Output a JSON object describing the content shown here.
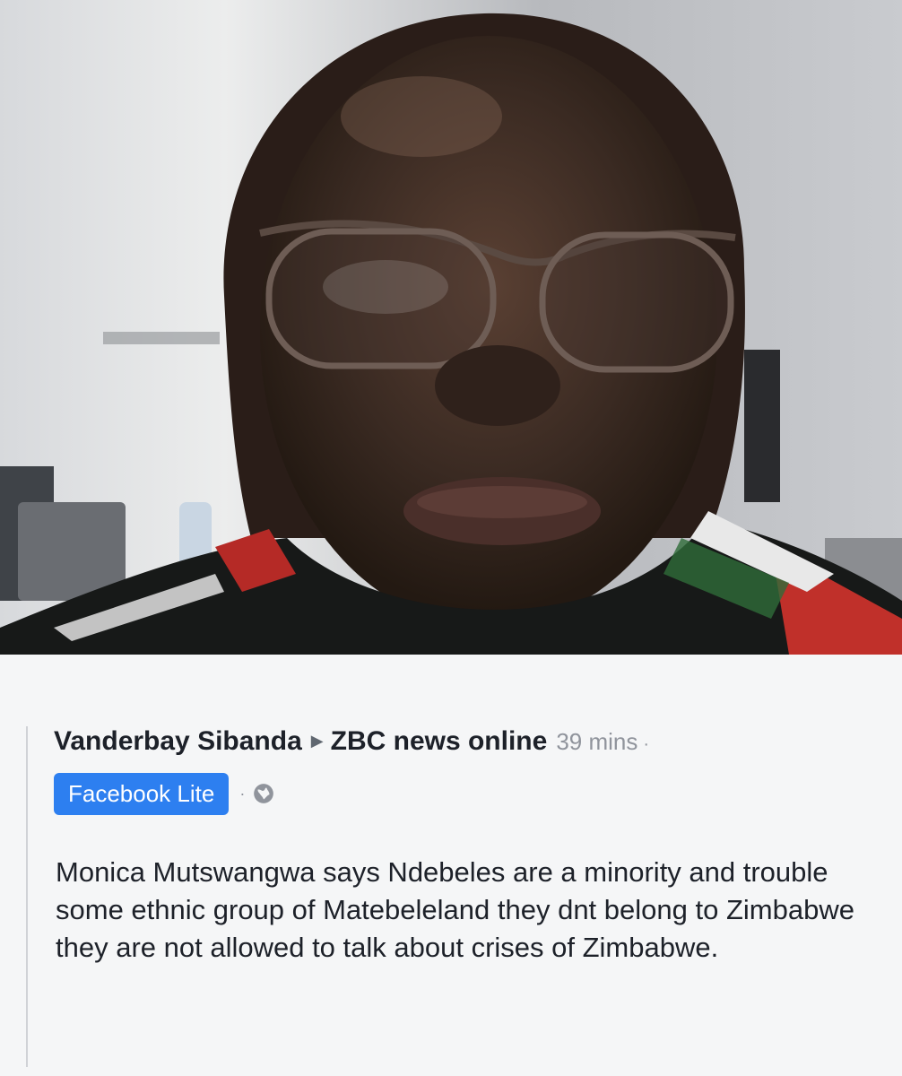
{
  "post": {
    "author": "Vanderbay Sibanda",
    "group": "ZBC news online",
    "time": "39 mins",
    "separator": "·",
    "app_badge": "Facebook Lite",
    "body": "Monica Mutswangwa says Ndebeles are a minority and trouble some ethnic group of Matebeleland they dnt belong to Zimbabwe they are not allowed to talk about crises of Zimbabwe."
  },
  "icons": {
    "arrow": "right-triangle-icon",
    "privacy": "globe-icon"
  },
  "colors": {
    "badge": "#2d7ff0",
    "text": "#1d2129",
    "meta": "#90949c"
  }
}
